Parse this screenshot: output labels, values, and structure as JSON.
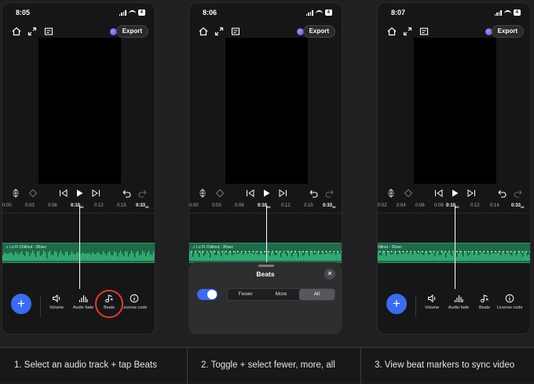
{
  "panels": [
    {
      "time": "8:05",
      "battery": "4",
      "export_label": "Export",
      "ruler": [
        "0:00",
        "0:03",
        "0:06",
        "0:10",
        "0:12",
        "0:15",
        "0:33"
      ],
      "ruler_current_frames": "06",
      "ruler_end_frames": "26",
      "track_label": "Lo Fi Chillout - 30sec",
      "tools": [
        "Volume",
        "Audio fade",
        "Beats",
        "License code"
      ],
      "beats_highlighted": true
    },
    {
      "time": "8:06",
      "battery": "4",
      "export_label": "Export",
      "ruler": [
        "0:00",
        "0:03",
        "0:06",
        "0:10",
        "0:12",
        "0:15",
        "0:33"
      ],
      "ruler_current_frames": "06",
      "ruler_end_frames": "26",
      "track_label": "Lo Fi Chillout - 30sec",
      "sheet": {
        "title": "Beats",
        "close_icon": "close-icon",
        "toggle_on": true,
        "options": [
          "Fewer",
          "More",
          "All"
        ],
        "selected": "All"
      }
    },
    {
      "time": "8:07",
      "battery": "4",
      "export_label": "Export",
      "ruler": [
        "0:02",
        "0:04",
        "0:06",
        "0:08",
        "0:10",
        "0:12",
        "0:14",
        "0:33"
      ],
      "ruler_current_frames": "06",
      "ruler_end_frames": "26",
      "track_label": "hillout - 30sec",
      "tools": [
        "Volume",
        "Audio fade",
        "Beats",
        "License code"
      ]
    }
  ],
  "captions": [
    "1.   Select an audio track + tap Beats",
    "2.   Toggle + select fewer, more, all",
    "3.   View beat markers to sync video"
  ],
  "colors": {
    "accent_blue": "#3b6cf0",
    "track_green": "#1e6b4a",
    "highlight_red": "#e53b2c"
  }
}
